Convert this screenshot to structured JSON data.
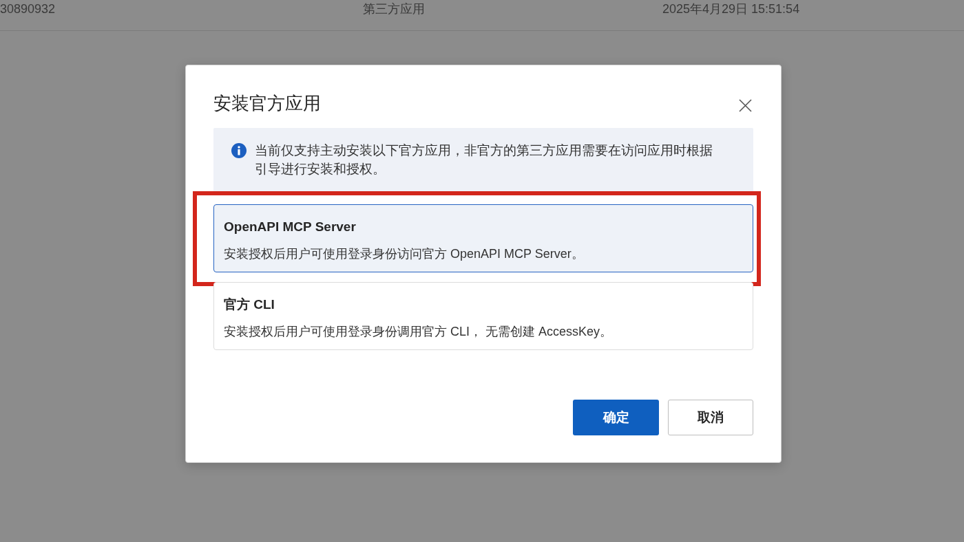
{
  "background_row": {
    "cells": [
      "30890932",
      "第三方应用",
      "2025年4月29日 15:51:54"
    ]
  },
  "dialog": {
    "title": "安装官方应用",
    "alert": {
      "text": "当前仅支持主动安装以下官方应用，非官方的第三方应用需要在访问应用时根据引导进行安装和授权。"
    },
    "options": [
      {
        "title": "OpenAPI MCP Server",
        "description": "安装授权后用户可使用登录身份访问官方 OpenAPI MCP Server。",
        "selected": true,
        "highlighted": true
      },
      {
        "title": "官方 CLI",
        "description": "安装授权后用户可使用登录身份调用官方 CLI， 无需创建 AccessKey。",
        "selected": false,
        "highlighted": false
      }
    ],
    "buttons": [
      {
        "label": "确定",
        "kind": "primary"
      },
      {
        "label": "取消",
        "kind": "secondary"
      }
    ]
  }
}
